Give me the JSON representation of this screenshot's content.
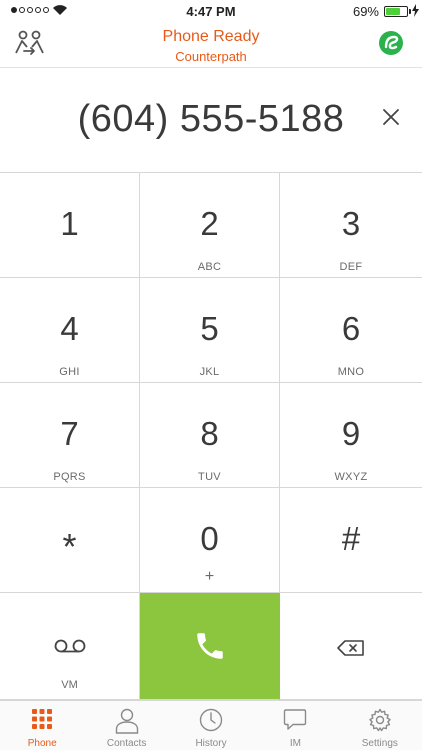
{
  "status_bar": {
    "time": "4:47 PM",
    "battery_percent": "69%",
    "battery_level": 0.69,
    "signal_bars": 1
  },
  "header": {
    "title": "Phone Ready",
    "subtitle": "Counterpath",
    "left_icon": "account-swap-icon",
    "right_icon": "bria-logo-icon"
  },
  "dialer": {
    "number": "(604) 555-5188"
  },
  "keypad": {
    "keys": [
      {
        "digit": "1",
        "letters": ""
      },
      {
        "digit": "2",
        "letters": "ABC"
      },
      {
        "digit": "3",
        "letters": "DEF"
      },
      {
        "digit": "4",
        "letters": "GHI"
      },
      {
        "digit": "5",
        "letters": "JKL"
      },
      {
        "digit": "6",
        "letters": "MNO"
      },
      {
        "digit": "7",
        "letters": "PQRS"
      },
      {
        "digit": "8",
        "letters": "TUV"
      },
      {
        "digit": "9",
        "letters": "WXYZ"
      },
      {
        "digit": "*",
        "letters": ""
      },
      {
        "digit": "0",
        "letters": "+"
      },
      {
        "digit": "#",
        "letters": ""
      }
    ],
    "voicemail_label": "VM"
  },
  "colors": {
    "accent": "#e85a1a",
    "call_green": "#8cc63f",
    "logo_green": "#2bb24c"
  },
  "tabs": [
    {
      "label": "Phone",
      "icon": "keypad-grid-icon",
      "active": true
    },
    {
      "label": "Contacts",
      "icon": "person-icon",
      "active": false
    },
    {
      "label": "History",
      "icon": "clock-icon",
      "active": false
    },
    {
      "label": "IM",
      "icon": "chat-bubble-icon",
      "active": false
    },
    {
      "label": "Settings",
      "icon": "gear-icon",
      "active": false
    }
  ]
}
